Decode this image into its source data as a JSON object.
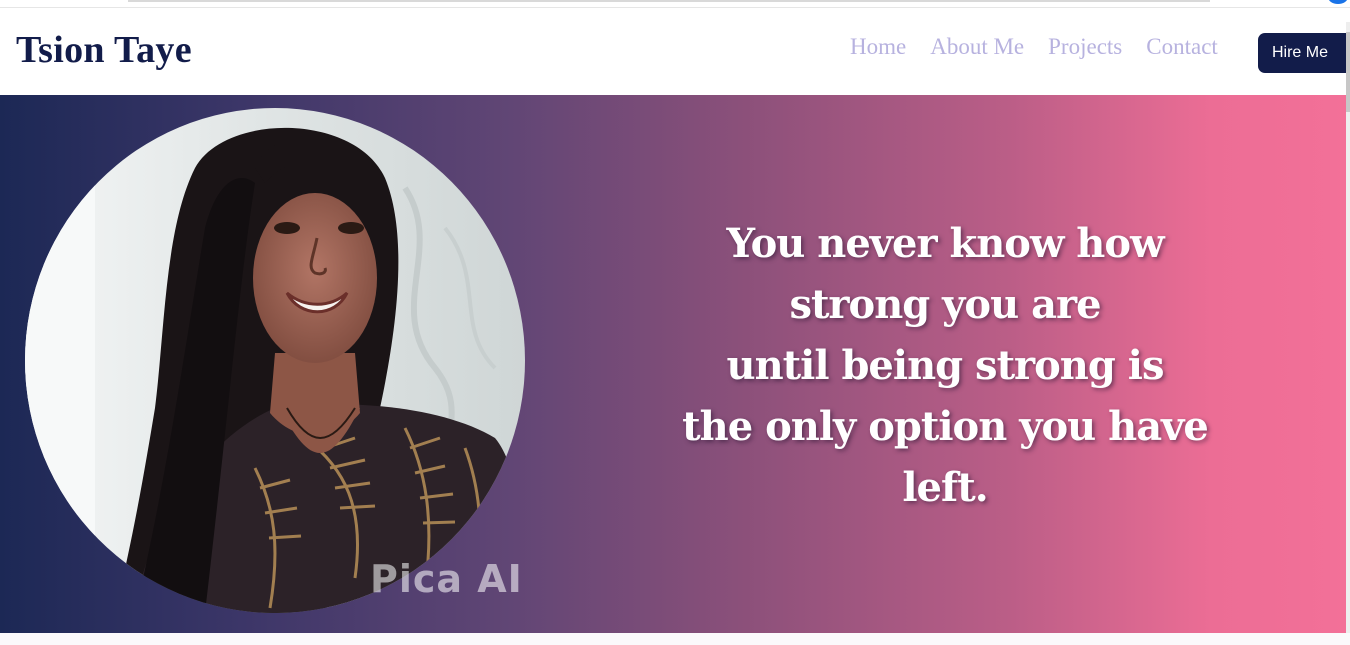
{
  "header": {
    "brand": "Tsion Taye",
    "nav": [
      {
        "label": "Home"
      },
      {
        "label": "About Me"
      },
      {
        "label": "Projects"
      },
      {
        "label": "Contact"
      }
    ],
    "hire_label": "Hire Me"
  },
  "hero": {
    "quote_lines": [
      "You never know how",
      "strong you are",
      "until being strong is",
      "the only option you have",
      "left."
    ],
    "watermark": "Pica AI",
    "portrait_icon": "profile-photo"
  },
  "colors": {
    "brand": "#121c4a",
    "nav_text": "#b7b2df",
    "gradient_start": "#1c2855",
    "gradient_end": "#f37098"
  }
}
